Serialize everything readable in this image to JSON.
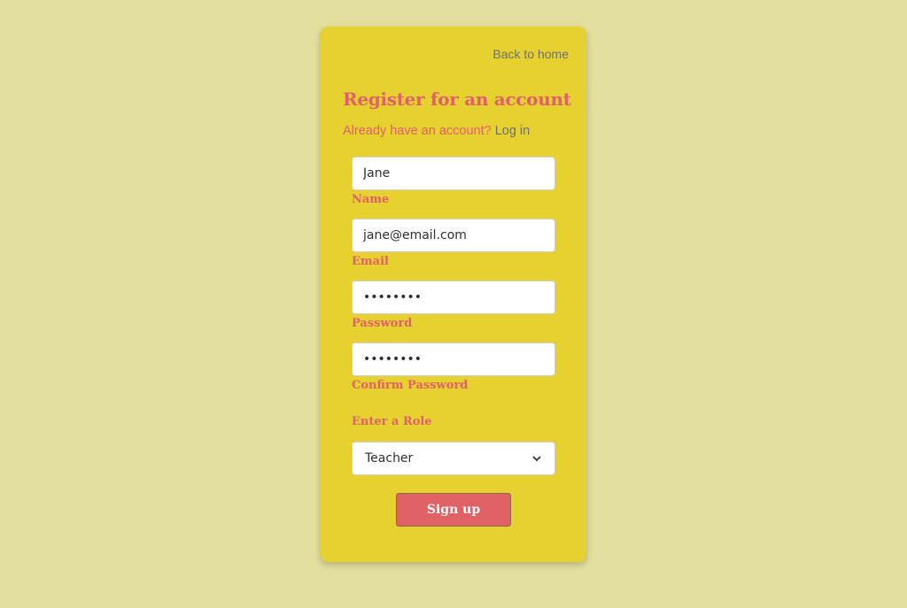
{
  "header": {
    "back_link": "Back to home"
  },
  "form": {
    "title": "Register for an account",
    "subtitle_prefix": "Already have an account?",
    "login_link": "Log in",
    "fields": {
      "name": {
        "value": "Jane",
        "label": "Name"
      },
      "email": {
        "value": "jane@email.com",
        "label": "Email"
      },
      "password": {
        "value": "••••••••",
        "label": "Password"
      },
      "confirm_password": {
        "value": "••••••••",
        "label": "Confirm Password"
      }
    },
    "role": {
      "label": "Enter a Role",
      "selected": "Teacher"
    },
    "submit_label": "Sign up"
  },
  "colors": {
    "background": "#e3df9e",
    "card": "#e6d12f",
    "accent": "#e0606b",
    "link": "#6f6f6f",
    "button": "#e06165"
  }
}
